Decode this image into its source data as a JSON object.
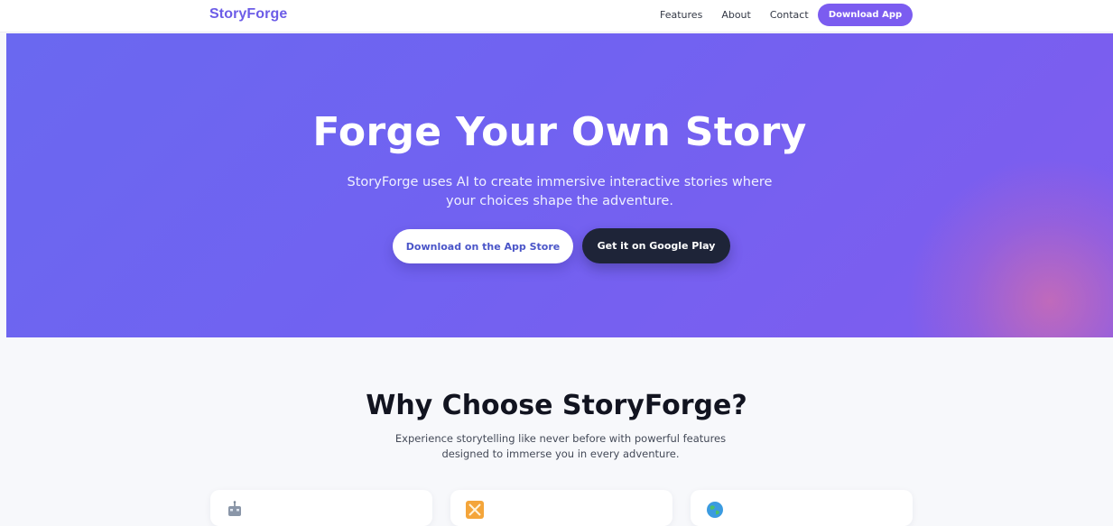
{
  "nav": {
    "brand": "StoryForge",
    "links": [
      "Features",
      "About",
      "Contact"
    ],
    "cta": "Download App"
  },
  "hero": {
    "title": "Forge Your Own Story",
    "subtitle": "StoryForge uses AI to create immersive interactive stories where your choices shape the adventure.",
    "app_store_label": "Download on the App Store",
    "google_play_label": "Get it on Google Play"
  },
  "features": {
    "title": "Why Choose StoryForge?",
    "subtitle": "Experience storytelling like never before with powerful features designed to immerse you in every adventure.",
    "cards": [
      {
        "icon": "robot-icon"
      },
      {
        "icon": "crossed-swords-icon"
      },
      {
        "icon": "globe-icon"
      }
    ]
  },
  "colors": {
    "brand": "#6c5ce7",
    "cta": "#7b5cf0",
    "hero_start": "#6a68f0",
    "hero_end": "#805cee",
    "dark_button": "#1e2438"
  }
}
